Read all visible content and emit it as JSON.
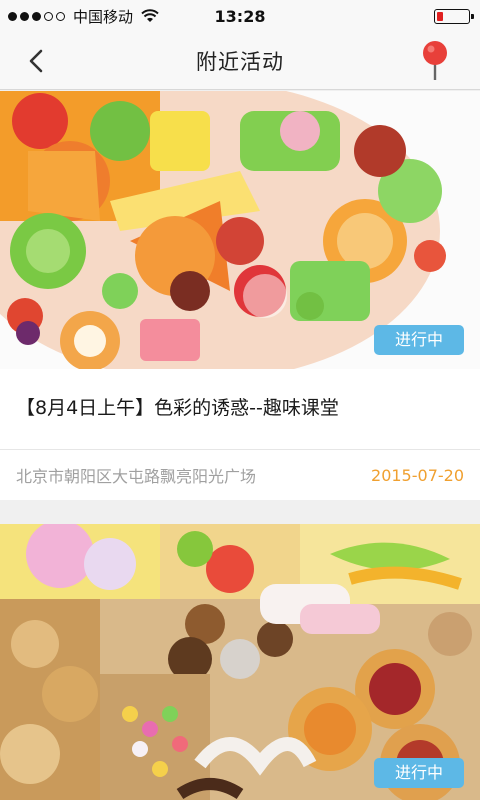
{
  "status_bar": {
    "carrier": "中国移动",
    "time": "13:28",
    "signal_strength": 3,
    "signal_max": 5,
    "battery_level": 0.2
  },
  "nav": {
    "title": "附近活动",
    "back_icon": "chevron-left-icon",
    "right_icon": "map-pin-icon"
  },
  "activities": [
    {
      "image_description": "colorful candies",
      "status": "进行中",
      "title": "【8月4日上午】色彩的诱惑--趣味课堂",
      "address": "北京市朝阳区大屯路飘亮阳光广场",
      "date": "2015-07-20"
    },
    {
      "image_description": "cookies and sweets",
      "status": "进行中"
    }
  ],
  "colors": {
    "badge": "#5db8e6",
    "date": "#f0a030",
    "pin": "#e8403a"
  }
}
